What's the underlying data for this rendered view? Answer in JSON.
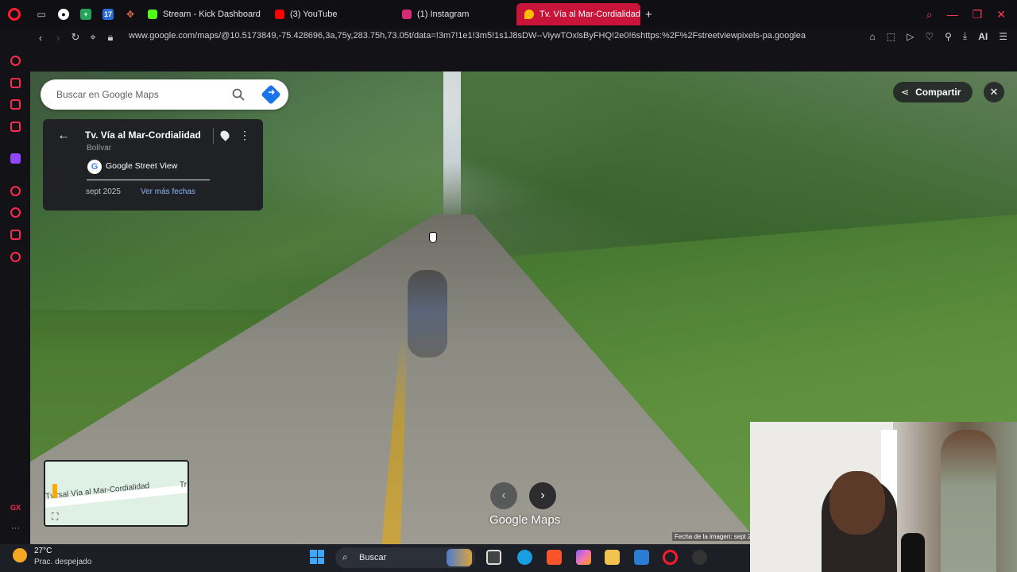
{
  "browser": {
    "tabs": [
      {
        "label": "Stream - Kick Dashboard",
        "favicon": "kick-icon",
        "color": "#53fc18"
      },
      {
        "label": "(3) YouTube",
        "favicon": "youtube-icon",
        "color": "#ff0000"
      },
      {
        "label": "(1) Instagram",
        "favicon": "instagram-icon",
        "color": "#d62976"
      },
      {
        "label": "Tv. Vía al Mar-Cordialidad",
        "favicon": "maps-icon",
        "color": "#ea4335",
        "active": true
      }
    ],
    "new_tab": "+",
    "url": "www.google.com/maps/@10.5173849,-75.428696,3a,75y,283.75h,73.05t/data=!3m7!1e1!3m5!1s1J8sDW--ViywTOxlsByFHQ!2e0!6shttps:%2F%2Fstreetviewpixels-pa.googlea",
    "ai_label": "AI",
    "accent": "#ff1b2d"
  },
  "maps": {
    "search_placeholder": "Buscar en Google Maps",
    "place_title": "Tv. Vía al Mar-Cordialidad",
    "place_region": "Bolívar",
    "source": "Google Street View",
    "date": "sept 2025",
    "more_dates": "Ver más fechas",
    "share_label": "Compartir",
    "minimap_label": "Tv.rsal Vía al Mar-Cordialidad",
    "minimap_label2": "Tr",
    "brand": "Google Maps",
    "image_date": "Fecha de la imagen: sept 2"
  },
  "taskbar": {
    "temperature": "27°C",
    "condition": "Prac. despejado",
    "search_label": "Buscar"
  }
}
